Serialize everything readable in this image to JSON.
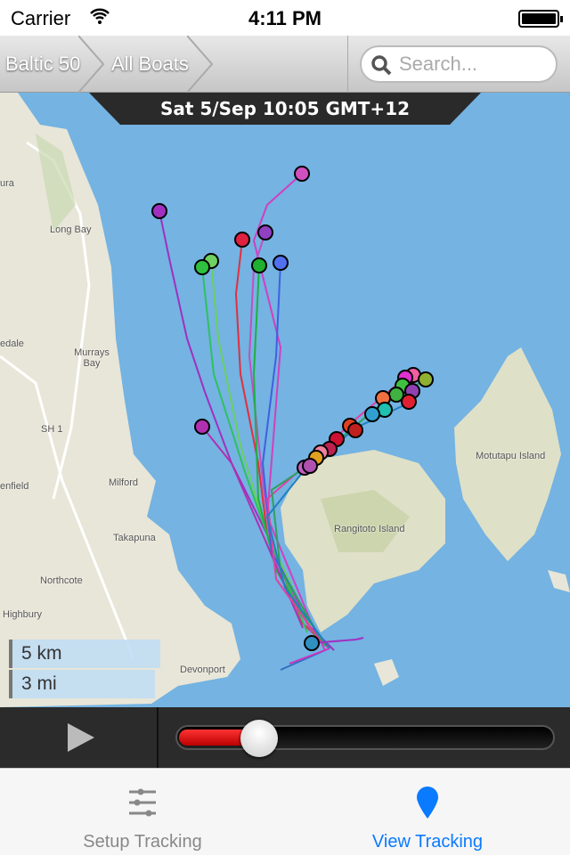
{
  "status_bar": {
    "carrier": "Carrier",
    "time": "4:11 PM"
  },
  "nav": {
    "breadcrumbs": [
      "Baltic 50",
      "All Boats"
    ],
    "search_placeholder": "Search..."
  },
  "map": {
    "date_label": "Sat 5/Sep 10:05 GMT+12",
    "place_labels": [
      "Long Bay",
      "Murrays Bay",
      "Milford",
      "Takapuna",
      "Northcote",
      "Highbury",
      "Devonport",
      "Rangitoto Island",
      "Motutapu Island",
      "SH 1",
      "edale",
      "enfield",
      "ura"
    ],
    "scale": {
      "km": "5 km",
      "mi": "3 mi"
    },
    "colors": {
      "water": "#74b3e2",
      "land": "#e8e6d8"
    }
  },
  "player": {
    "progress": 0.17,
    "accent": "#dd0000"
  },
  "tabs": [
    {
      "label": "Setup Tracking",
      "icon": "sliders-icon",
      "active": false
    },
    {
      "label": "View Tracking",
      "icon": "map-pin-icon",
      "active": true
    }
  ],
  "accent": "#0a7aff"
}
